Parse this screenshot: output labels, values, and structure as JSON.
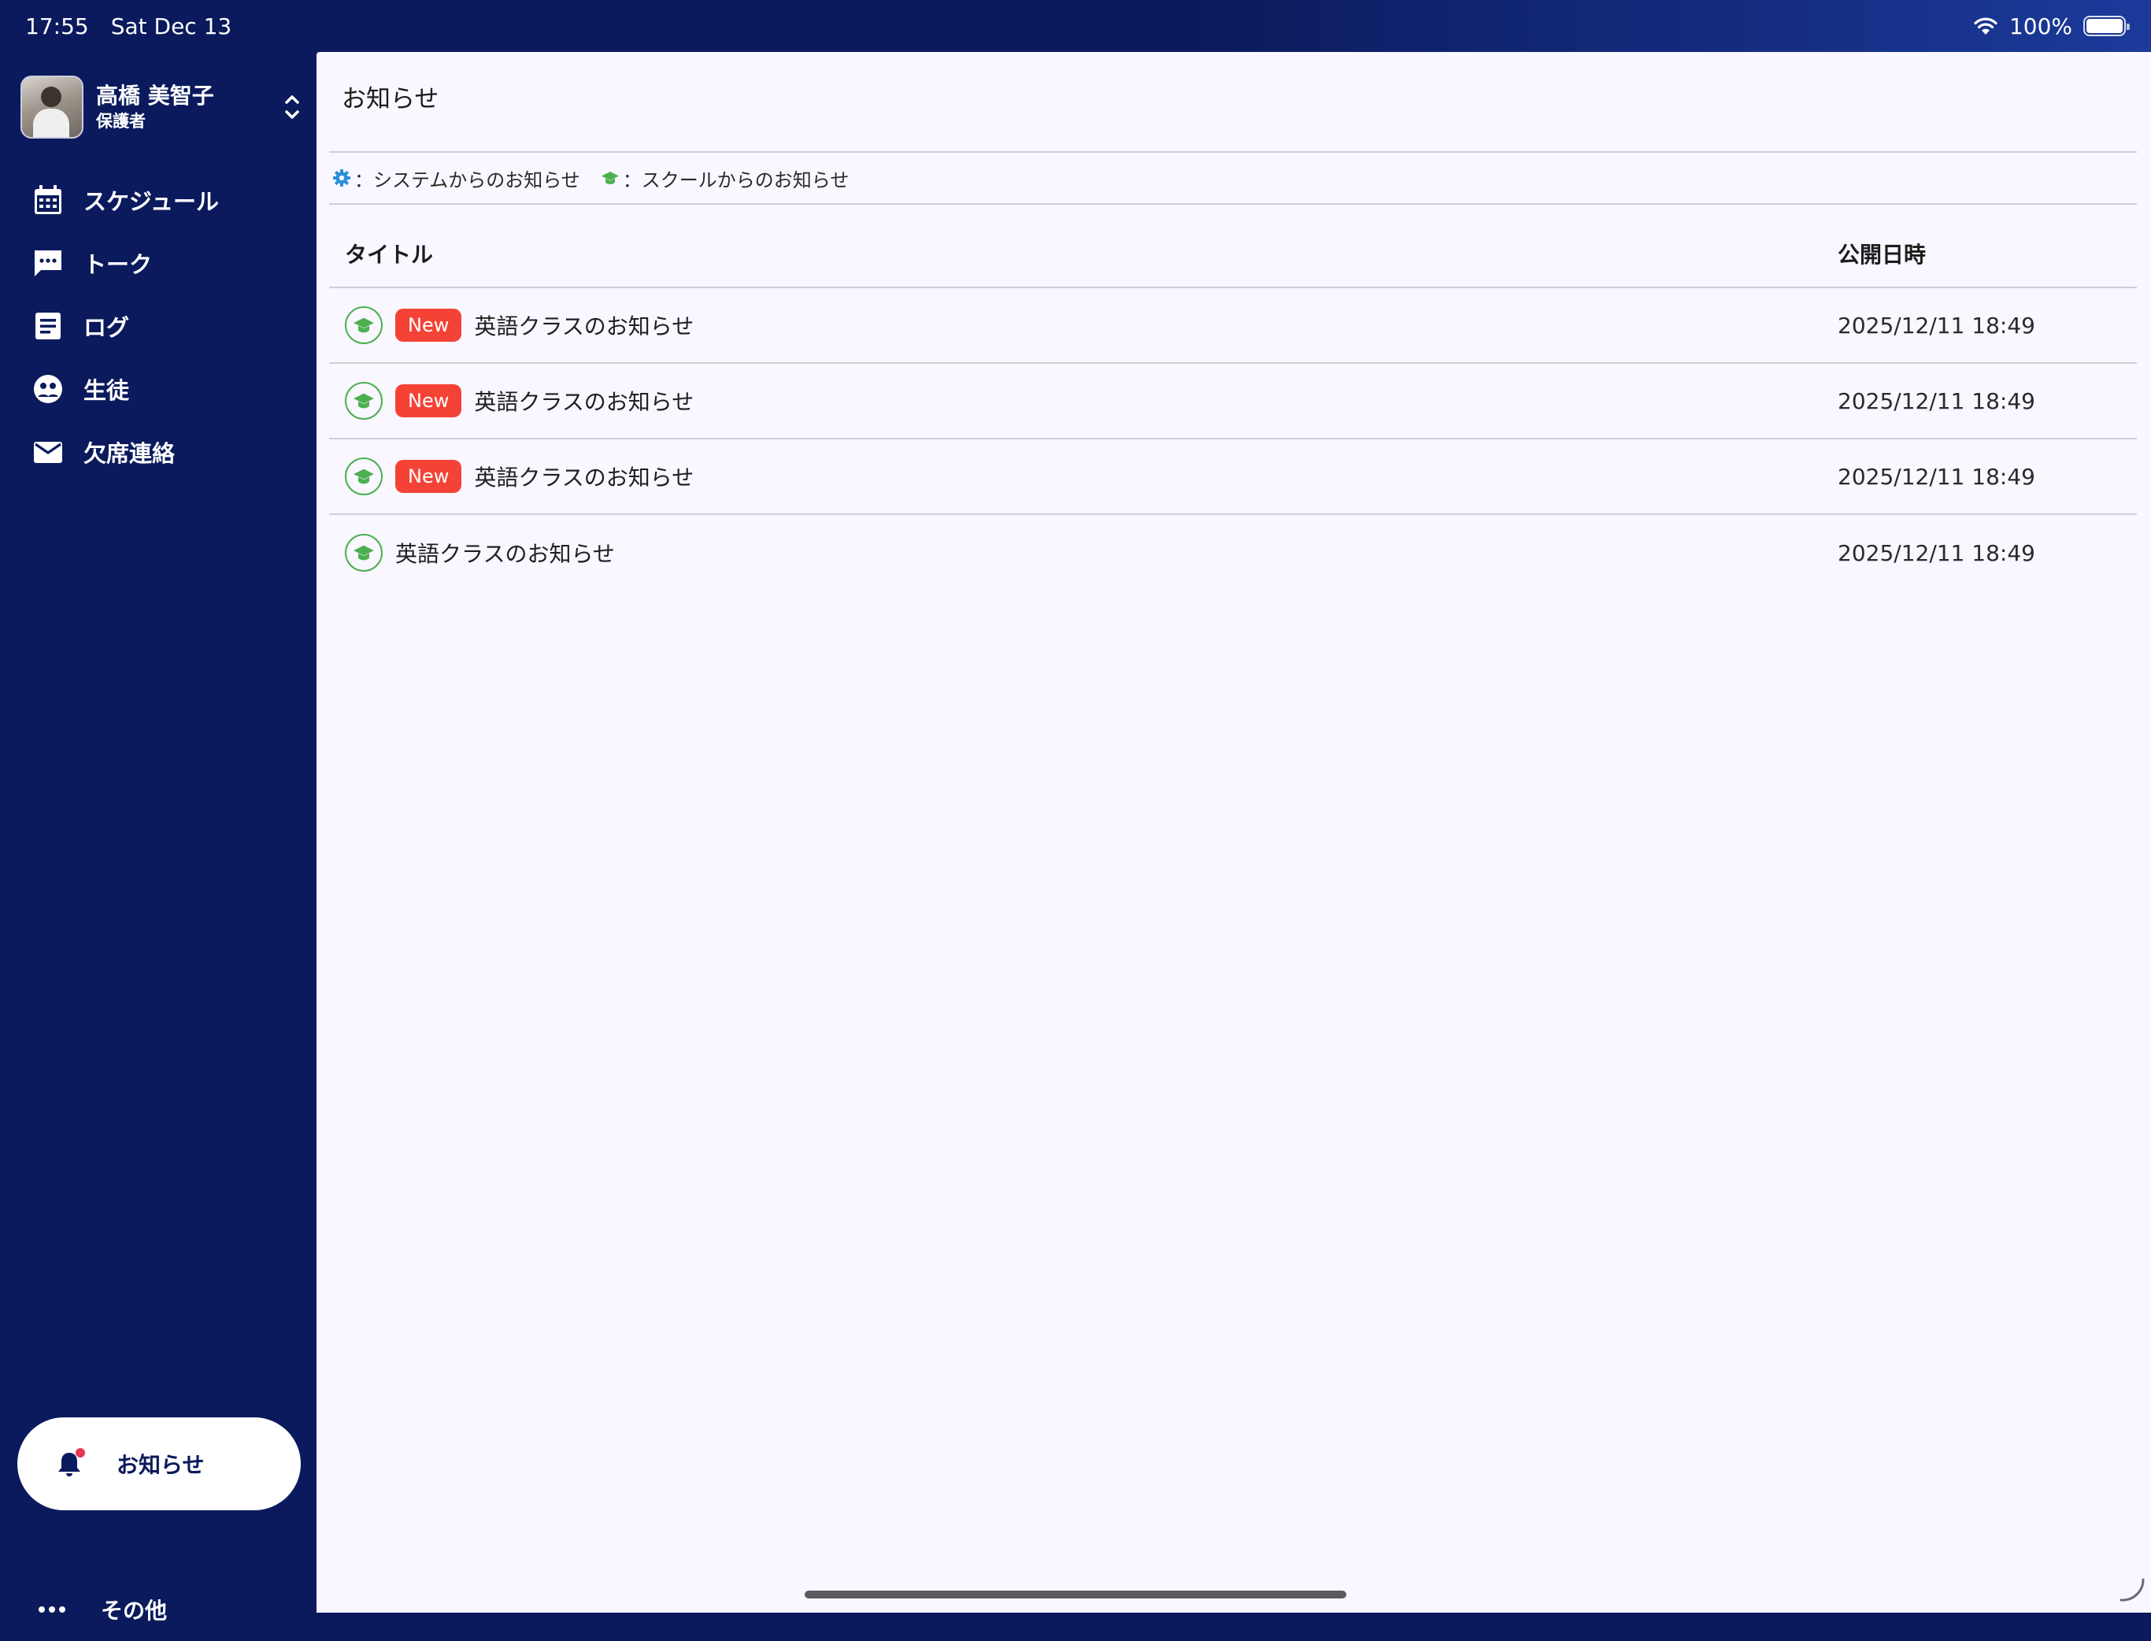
{
  "status_bar": {
    "time": "17:55",
    "date": "Sat Dec 13",
    "battery": "100%",
    "battery_level": 1.0,
    "wifi_icon": "wifi-icon"
  },
  "profile": {
    "name": "高橋 美智子",
    "role": "保護者"
  },
  "nav": {
    "items": [
      {
        "label": "スケジュール",
        "icon": "calendar-icon"
      },
      {
        "label": "トーク",
        "icon": "chat-icon"
      },
      {
        "label": "ログ",
        "icon": "document-icon"
      },
      {
        "label": "生徒",
        "icon": "student-icon"
      },
      {
        "label": "欠席連絡",
        "icon": "mail-icon"
      }
    ],
    "notice_label": "お知らせ",
    "more_label": "その他"
  },
  "main": {
    "title": "お知らせ",
    "legend": {
      "system": "：システムからのお知らせ",
      "school": "：スクールからのお知らせ"
    },
    "columns": {
      "title": "タイトル",
      "date": "公開日時"
    },
    "rows": [
      {
        "badge": "New",
        "title": "英語クラスのお知らせ",
        "date": "2025/12/11 18:49",
        "source": "school"
      },
      {
        "badge": "New",
        "title": "英語クラスのお知らせ",
        "date": "2025/12/11 18:49",
        "source": "school"
      },
      {
        "badge": "New",
        "title": "英語クラスのお知らせ",
        "date": "2025/12/11 18:49",
        "source": "school"
      },
      {
        "badge": "",
        "title": "英語クラスのお知らせ",
        "date": "2025/12/11 18:49",
        "source": "school"
      }
    ]
  },
  "colors": {
    "sidebar_bg": "#0b1a5c",
    "main_bg": "#f9f7ff",
    "school_icon": "#4caf50",
    "system_icon": "#2b8fd8",
    "new_badge": "#f44336",
    "notification_dot": "#e53950"
  }
}
